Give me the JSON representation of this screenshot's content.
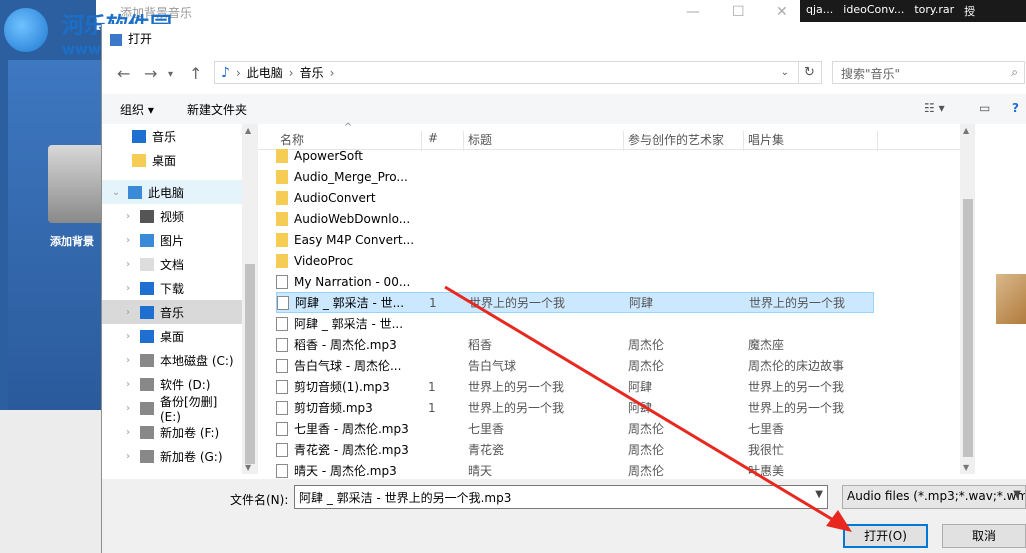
{
  "watermark": {
    "title": "河乐软件园",
    "url": "www.pc0359.cn"
  },
  "background_app": {
    "tile_label": "添加背景"
  },
  "outer_window": {
    "title": "添加背景音乐"
  },
  "taskbar": [
    "qja...",
    "ideoConv...",
    "tory.rar",
    "授"
  ],
  "dialog": {
    "title": "打开",
    "breadcrumb": [
      "此电脑",
      "音乐"
    ],
    "search_placeholder": "搜索\"音乐\"",
    "toolbar": {
      "organize": "组织 ▾",
      "new_folder": "新建文件夹"
    },
    "nav_items": [
      {
        "label": "音乐",
        "icon": "music-note-icon",
        "selected": false
      },
      {
        "label": "桌面",
        "icon": "folder-icon",
        "selected": false
      },
      {
        "label": "此电脑",
        "icon": "computer-icon",
        "selected": false,
        "highlight": true
      },
      {
        "label": "视频",
        "icon": "video-icon",
        "selected": false
      },
      {
        "label": "图片",
        "icon": "picture-icon",
        "selected": false
      },
      {
        "label": "文档",
        "icon": "document-icon",
        "selected": false
      },
      {
        "label": "下载",
        "icon": "download-icon",
        "selected": false
      },
      {
        "label": "音乐",
        "icon": "music-note-icon",
        "selected": true
      },
      {
        "label": "桌面",
        "icon": "desktop-icon",
        "selected": false
      },
      {
        "label": "本地磁盘 (C:)",
        "icon": "drive-icon",
        "selected": false
      },
      {
        "label": "软件 (D:)",
        "icon": "drive-icon",
        "selected": false
      },
      {
        "label": "备份[勿删] (E:)",
        "icon": "drive-icon",
        "selected": false
      },
      {
        "label": "新加卷 (F:)",
        "icon": "drive-icon",
        "selected": false
      },
      {
        "label": "新加卷 (G:)",
        "icon": "drive-icon",
        "selected": false
      }
    ],
    "columns": {
      "name": "名称",
      "num": "#",
      "title": "标题",
      "artist": "参与创作的艺术家",
      "album": "唱片集"
    },
    "files": [
      {
        "name": "ApowerSoft",
        "type": "folder",
        "num": "",
        "title": "",
        "artist": "",
        "album": ""
      },
      {
        "name": "Audio_Merge_Pro...",
        "type": "folder",
        "num": "",
        "title": "",
        "artist": "",
        "album": ""
      },
      {
        "name": "AudioConvert",
        "type": "folder",
        "num": "",
        "title": "",
        "artist": "",
        "album": ""
      },
      {
        "name": "AudioWebDownlo...",
        "type": "folder",
        "num": "",
        "title": "",
        "artist": "",
        "album": ""
      },
      {
        "name": "Easy M4P Convert...",
        "type": "folder",
        "num": "",
        "title": "",
        "artist": "",
        "album": ""
      },
      {
        "name": "VideoProc",
        "type": "folder",
        "num": "",
        "title": "",
        "artist": "",
        "album": ""
      },
      {
        "name": "My Narration - 00...",
        "type": "audio",
        "num": "",
        "title": "",
        "artist": "",
        "album": ""
      },
      {
        "name": "阿肆 _ 郭采洁 - 世...",
        "type": "audio",
        "num": "1",
        "title": "世界上的另一个我",
        "artist": "阿肆",
        "album": "世界上的另一个我",
        "selected": true
      },
      {
        "name": "阿肆 _ 郭采洁 - 世...",
        "type": "audio",
        "num": "",
        "title": "",
        "artist": "",
        "album": ""
      },
      {
        "name": "稻香 - 周杰伦.mp3",
        "type": "audio",
        "num": "",
        "title": "稻香",
        "artist": "周杰伦",
        "album": "魔杰座"
      },
      {
        "name": "告白气球 - 周杰伦...",
        "type": "audio",
        "num": "",
        "title": "告白气球",
        "artist": "周杰伦",
        "album": "周杰伦的床边故事"
      },
      {
        "name": "剪切音频(1).mp3",
        "type": "audio",
        "num": "1",
        "title": "世界上的另一个我",
        "artist": "阿肆",
        "album": "世界上的另一个我"
      },
      {
        "name": "剪切音频.mp3",
        "type": "audio",
        "num": "1",
        "title": "世界上的另一个我",
        "artist": "阿肆",
        "album": "世界上的另一个我"
      },
      {
        "name": "七里香 - 周杰伦.mp3",
        "type": "audio",
        "num": "",
        "title": "七里香",
        "artist": "周杰伦",
        "album": "七里香"
      },
      {
        "name": "青花瓷 - 周杰伦.mp3",
        "type": "audio",
        "num": "",
        "title": "青花瓷",
        "artist": "周杰伦",
        "album": "我很忙"
      },
      {
        "name": "晴天 - 周杰伦.mp3",
        "type": "audio",
        "num": "",
        "title": "晴天",
        "artist": "周杰伦",
        "album": "叶惠美"
      }
    ],
    "filename_label": "文件名(N):",
    "filename_value": "阿肆 _ 郭采洁 - 世界上的另一个我.mp3",
    "filetype_value": "Audio files (*.mp3;*.wav;*.wm",
    "open_button": "打开(O)",
    "cancel_button": "取消",
    "accent_color": "#0078d7",
    "arrow_color": "#e8271f"
  }
}
